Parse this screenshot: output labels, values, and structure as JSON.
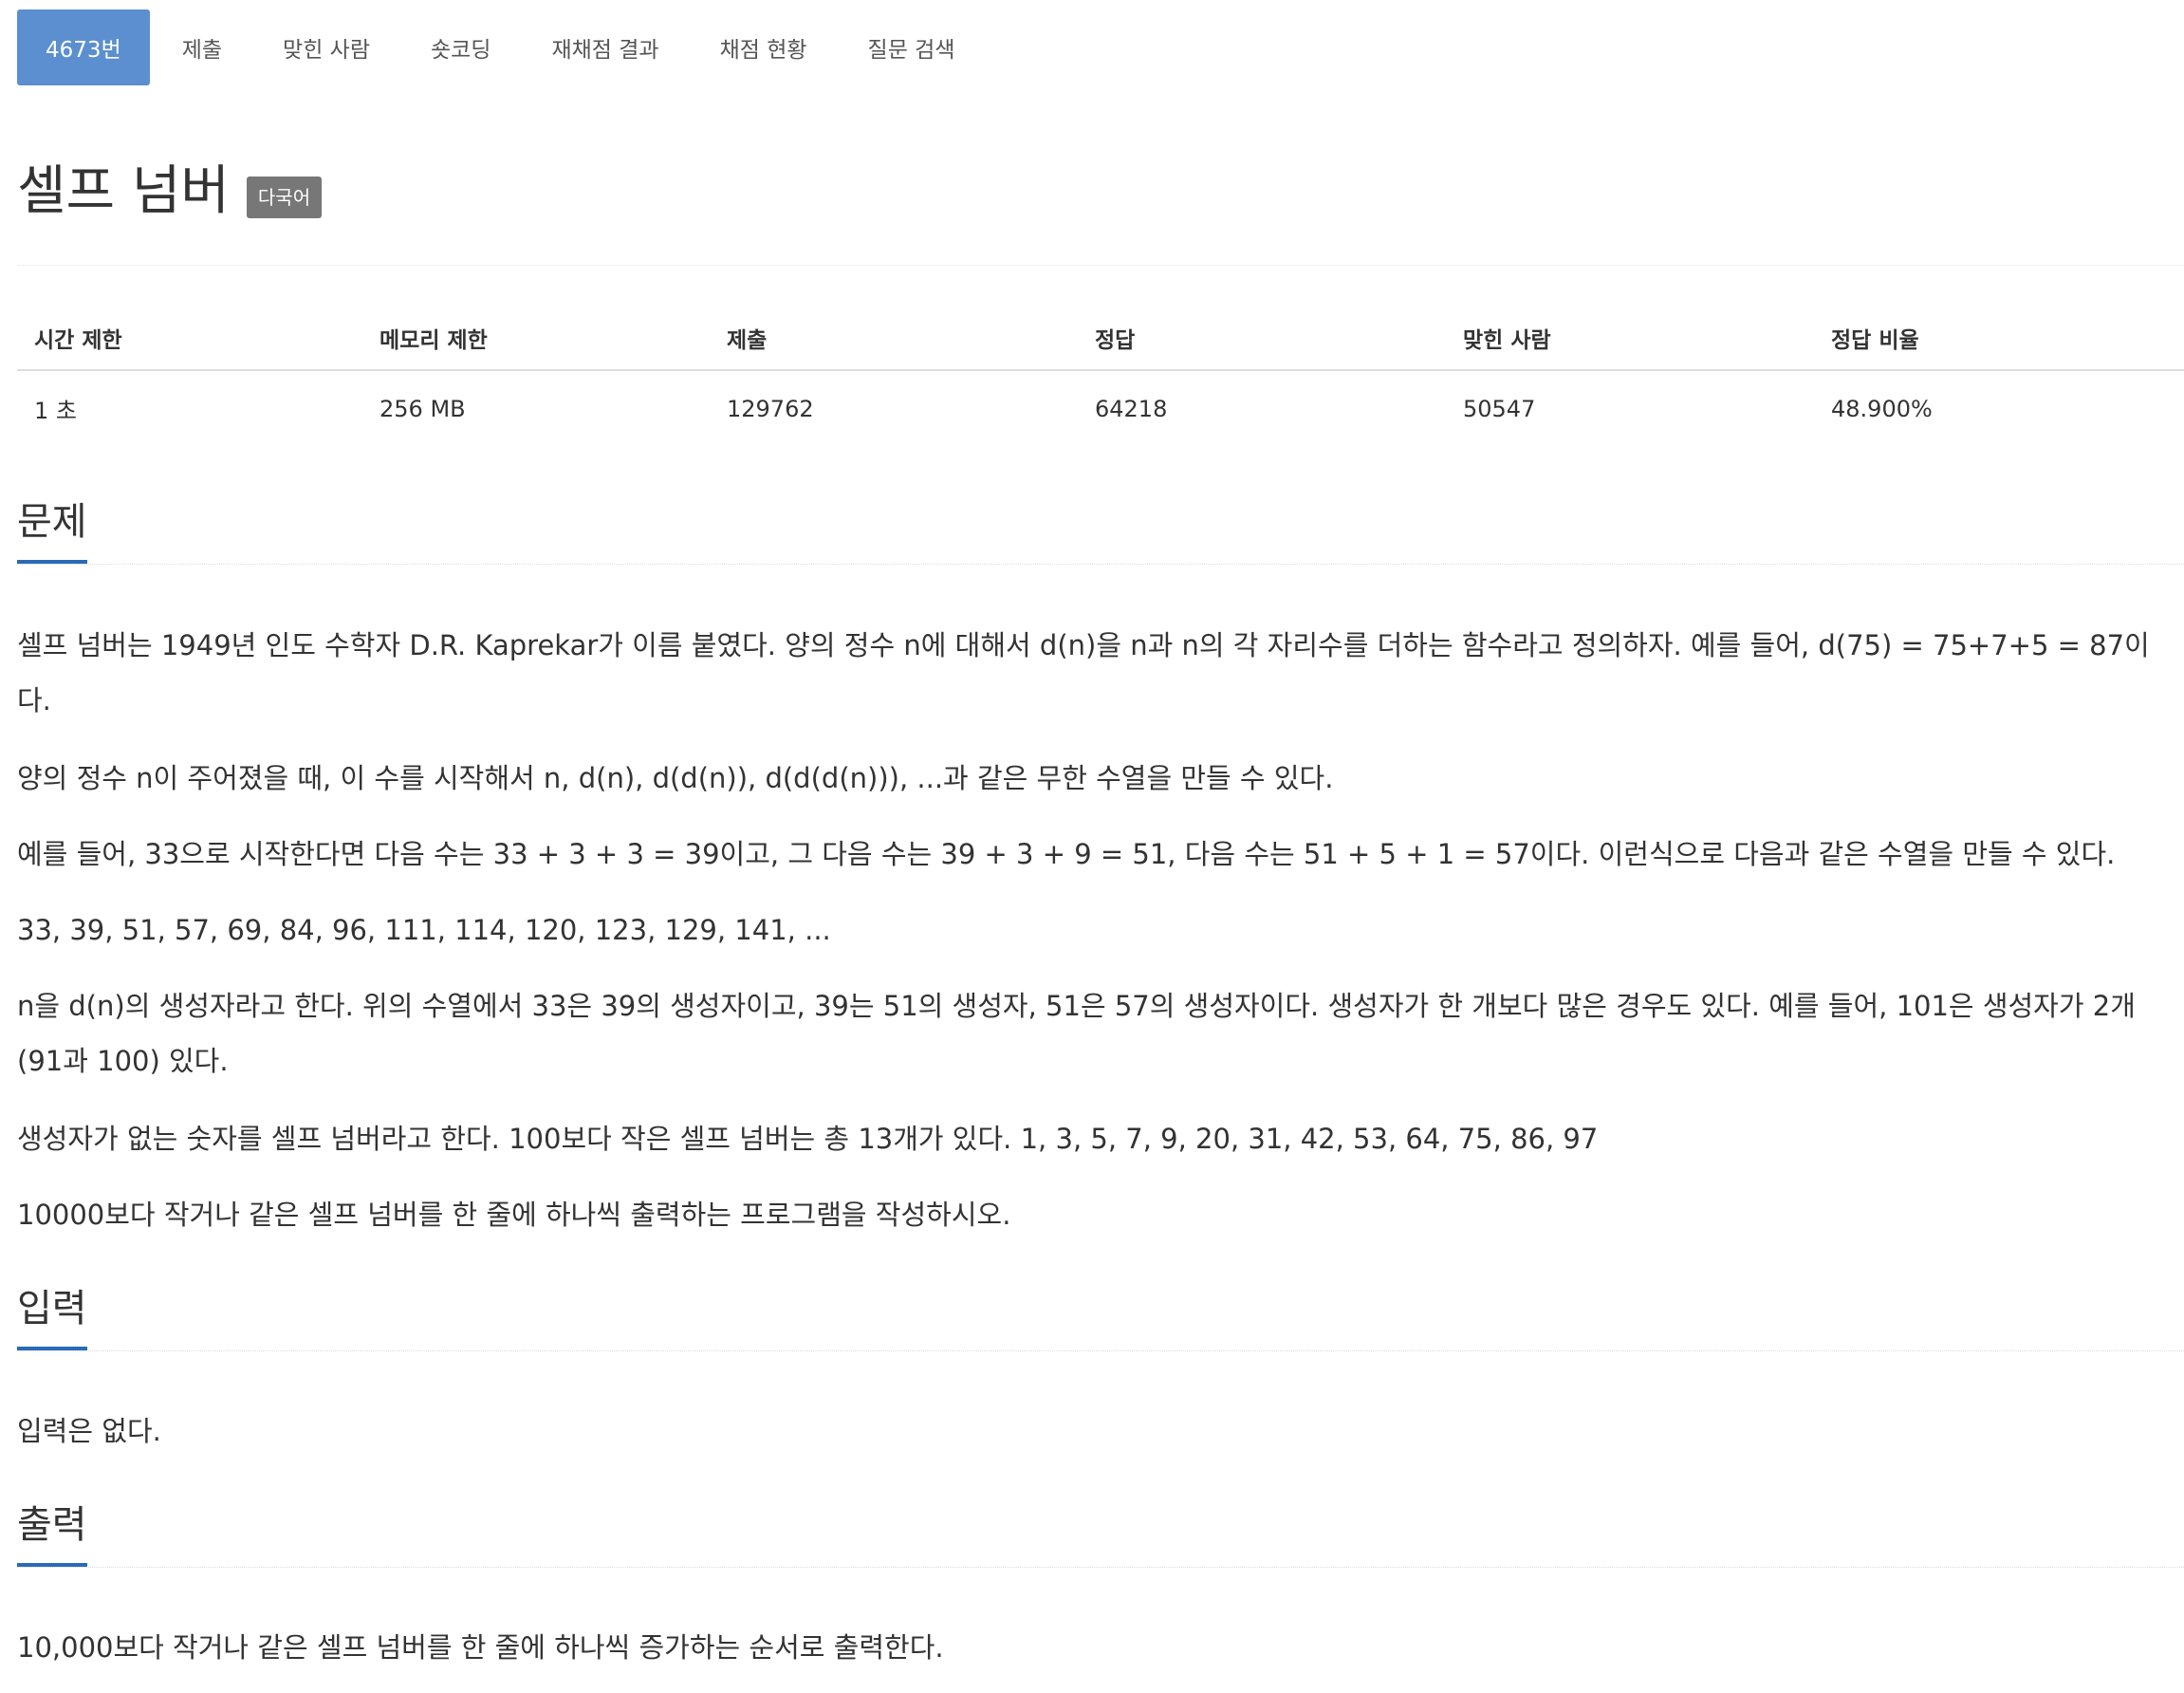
{
  "tabs": [
    {
      "label": "4673번",
      "active": true
    },
    {
      "label": "제출"
    },
    {
      "label": "맞힌 사람"
    },
    {
      "label": "숏코딩"
    },
    {
      "label": "재채점 결과"
    },
    {
      "label": "채점 현황"
    },
    {
      "label": "질문 검색"
    }
  ],
  "problem": {
    "title": "셀프 넘버",
    "badge": "다국어"
  },
  "info_table": {
    "headers": [
      "시간 제한",
      "메모리 제한",
      "제출",
      "정답",
      "맞힌 사람",
      "정답 비율"
    ],
    "values": [
      "1 초",
      "256 MB",
      "129762",
      "64218",
      "50547",
      "48.900%"
    ]
  },
  "sections": {
    "problem": {
      "heading": "문제",
      "lines": [
        "셀프 넘버는 1949년 인도 수학자 D.R. Kaprekar가 이름 붙였다. 양의 정수 n에 대해서 d(n)을 n과 n의 각 자리수를 더하는 함수라고 정의하자. 예를 들어, d(75) = 75+7+5 = 87이",
        "다.",
        "양의 정수 n이 주어졌을 때, 이 수를 시작해서 n, d(n), d(d(n)), d(d(d(n))), ...과 같은 무한 수열을 만들 수 있다.",
        "예를 들어, 33으로 시작한다면 다음 수는 33 + 3 + 3 = 39이고, 그 다음 수는 39 + 3 + 9 = 51, 다음 수는 51 + 5 + 1 = 57이다. 이런식으로 다음과 같은 수열을 만들 수 있다.",
        "33, 39, 51, 57, 69, 84, 96, 111, 114, 120, 123, 129, 141, ...",
        "n을 d(n)의 생성자라고 한다. 위의 수열에서 33은 39의 생성자이고, 39는 51의 생성자, 51은 57의 생성자이다. 생성자가 한 개보다 많은 경우도 있다. 예를 들어, 101은 생성자가 2개",
        "(91과 100) 있다.",
        "생성자가 없는 숫자를 셀프 넘버라고 한다. 100보다 작은 셀프 넘버는 총 13개가 있다. 1, 3, 5, 7, 9, 20, 31, 42, 53, 64, 75, 86, 97",
        "10000보다 작거나 같은 셀프 넘버를 한 줄에 하나씩 출력하는 프로그램을 작성하시오."
      ]
    },
    "input": {
      "heading": "입력",
      "lines": [
        "입력은 없다."
      ]
    },
    "output": {
      "heading": "출력",
      "lines": [
        "10,000보다 작거나 같은 셀프 넘버를 한 줄에 하나씩 증가하는 순서로 출력한다."
      ]
    }
  },
  "colors": {
    "tab_active_bg": "#5b8fcf",
    "heading_underline": "#2a6ab7",
    "badge_bg": "#777777"
  }
}
